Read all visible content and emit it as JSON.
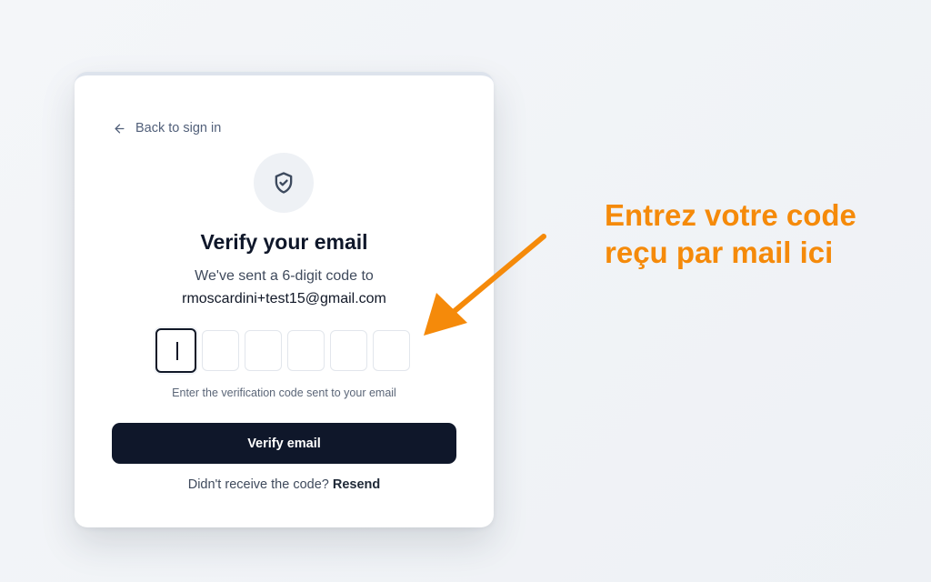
{
  "card": {
    "back_label": "Back to sign in",
    "title": "Verify your email",
    "subtitle": "We've sent a 6-digit code to",
    "email": "rmoscardini+test15@gmail.com",
    "code_boxes": [
      "",
      "",
      "",
      "",
      "",
      ""
    ],
    "active_box_index": 0,
    "hint": "Enter the verification code sent to your email",
    "verify_label": "Verify email",
    "resend_prompt": "Didn't receive the code?",
    "resend_label": "Resend"
  },
  "annotation": {
    "line1": "Entrez votre code",
    "line2": "reçu par mail ici",
    "color": "#f58a0a"
  },
  "icons": {
    "back": "arrow-left-icon",
    "shield": "shield-check-icon"
  }
}
